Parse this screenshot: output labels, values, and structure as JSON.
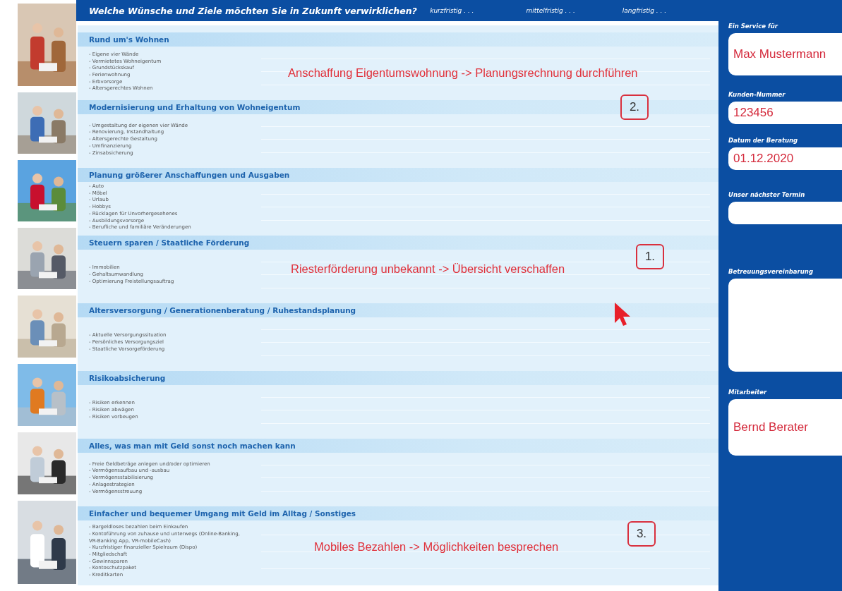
{
  "header": {
    "title": "Welche Wünsche und Ziele möchten Sie in Zukunft verwirklichen?",
    "columns": [
      "kurzfristig . . .",
      "mittelfristig . . .",
      "langfristig . . ."
    ]
  },
  "sections": [
    {
      "title": "Rund um's Wohnen",
      "items": [
        "- Eigene vier Wände",
        "- Vermietetes Wohneigentum",
        "- Grundstückskauf",
        "- Ferienwohnung",
        "- Erbvorsorge",
        "- Altersgerechtes Wohnen"
      ]
    },
    {
      "title": "Modernisierung und Erhaltung von Wohneigentum",
      "items": [
        "- Umgestaltung der eigenen vier Wände",
        "- Renovierung, Instandhaltung",
        "- Altersgerechte Gestaltung",
        "- Umfinanzierung",
        "- Zinsabsicherung"
      ]
    },
    {
      "title": "Planung größerer Anschaffungen und Ausgaben",
      "items": [
        "- Auto",
        "- Möbel",
        "- Urlaub",
        "- Hobbys",
        "- Rücklagen für Unvorhergesehenes",
        "- Ausbildungsvorsorge",
        "- Berufliche und familiäre Veränderungen"
      ]
    },
    {
      "title": "Steuern sparen / Staatliche Förderung",
      "items": [
        "- Immobilien",
        "- Gehaltsumwandlung",
        "- Optimierung Freistellungsauftrag"
      ]
    },
    {
      "title": "Altersversorgung / Generationenberatung / Ruhestandsplanung",
      "items": [
        "- Aktuelle Versorgungssituation",
        "- Persönliches Versorgungsziel",
        "- Staatliche Vorsorgeförderung"
      ]
    },
    {
      "title": "Risikoabsicherung",
      "items": [
        "- Risiken erkennen",
        "- Risiken abwägen",
        "- Risiken vorbeugen"
      ]
    },
    {
      "title": "Alles, was man mit Geld sonst noch machen kann",
      "items": [
        "- Freie Geldbeträge anlegen und/oder optimieren",
        "- Vermögensaufbau und -ausbau",
        "- Vermögensstabilisierung",
        "- Anlagestrategien",
        "- Vermögensstreuung"
      ]
    },
    {
      "title": "Einfacher und bequemer Umgang mit Geld im Alltag / Sonstiges",
      "items": [
        "- Bargeldloses bezahlen beim Einkaufen",
        "- Kontoführung von zuhause und unterwegs (Online-Banking, VR-Banking App, VR-mobileCash)",
        "- Kurzfristiger finanzieller Spielraum (Dispo)",
        "- Mitgliedschaft",
        "- Gewinnsparen",
        "- Kontoschutzpaket",
        "- Kreditkarten"
      ]
    }
  ],
  "annotations": [
    "Anschaffung Eigentumswohnung -> Planungsrechnung durchführen",
    "Riesterförderung unbekannt -> Übersicht verschaffen",
    "Mobiles Bezahlen -> Möglichkeiten besprechen"
  ],
  "step_markers": [
    "2.",
    "1.",
    "3."
  ],
  "sidebar": {
    "fields": [
      {
        "label": "Ein Service für",
        "value": "Max Mustermann"
      },
      {
        "label": "Kunden-Nummer",
        "value": "123456"
      },
      {
        "label": "Datum der Beratung",
        "value": "01.12.2020"
      },
      {
        "label": "Unser nächster Termin"
      },
      {
        "label": "Betreuungsvereinbarung"
      },
      {
        "label": "Mitarbeiter",
        "value": "Bernd Berater"
      }
    ]
  }
}
